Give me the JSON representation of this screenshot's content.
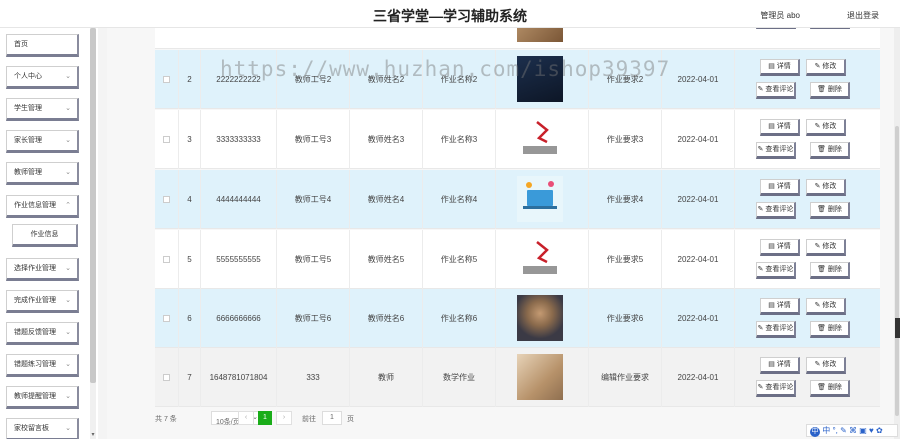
{
  "header": {
    "title": "三省学堂—学习辅助系统",
    "user": "管理员 abo",
    "logout": "退出登录"
  },
  "sidebar": {
    "items": [
      {
        "label": "首页",
        "chev": ""
      },
      {
        "label": "个人中心",
        "chev": "⌄"
      },
      {
        "label": "学生管理",
        "chev": "⌄"
      },
      {
        "label": "家长管理",
        "chev": "⌄"
      },
      {
        "label": "教师管理",
        "chev": "⌄"
      },
      {
        "label": "作业信息管理",
        "chev": "⌃"
      },
      {
        "label": "作业信息",
        "chev": ""
      },
      {
        "label": "选择作业管理",
        "chev": "⌄"
      },
      {
        "label": "完成作业管理",
        "chev": "⌄"
      },
      {
        "label": "错题反馈管理",
        "chev": "⌄"
      },
      {
        "label": "错题练习管理",
        "chev": "⌄"
      },
      {
        "label": "教师提醒管理",
        "chev": "⌄"
      },
      {
        "label": "家校留言板",
        "chev": "⌄"
      }
    ]
  },
  "table": {
    "rows": [
      {
        "idx": "2",
        "teacher_no": "2222222222",
        "teacher_id": "教师工号2",
        "teacher_name": "教师姓名2",
        "work_name": "作业名称2",
        "image": "dark-poster-image",
        "req": "作业要求2",
        "date": "2022-04-01"
      },
      {
        "idx": "3",
        "teacher_no": "3333333333",
        "teacher_id": "教师工号3",
        "teacher_name": "教师姓名3",
        "work_name": "作业名称3",
        "image": "sql-server-logo-image",
        "req": "作业要求3",
        "date": "2022-04-01"
      },
      {
        "idx": "4",
        "teacher_no": "4444444444",
        "teacher_id": "教师工号4",
        "teacher_name": "教师姓名4",
        "work_name": "作业名称4",
        "image": "laptop-illustration-image",
        "req": "作业要求4",
        "date": "2022-04-01"
      },
      {
        "idx": "5",
        "teacher_no": "5555555555",
        "teacher_id": "教师工号5",
        "teacher_name": "教师姓名5",
        "work_name": "作业名称5",
        "image": "sql-server-logo-image",
        "req": "作业要求5",
        "date": "2022-04-01"
      },
      {
        "idx": "6",
        "teacher_no": "6666666666",
        "teacher_id": "教师工号6",
        "teacher_name": "教师姓名6",
        "work_name": "作业名称6",
        "image": "student-photo-image",
        "req": "作业要求6",
        "date": "2022-04-01"
      },
      {
        "idx": "7",
        "teacher_no": "1648781071804",
        "teacher_id": "333",
        "teacher_name": "教师",
        "work_name": "数学作业",
        "image": "book-photo-image",
        "req": "编辑作业要求",
        "date": "2022-04-01"
      }
    ],
    "buttons": {
      "detail": "详情",
      "edit": "修改",
      "comments": "查看评论",
      "delete": "删除",
      "detail_icon": "document-icon",
      "edit_icon": "pencil-icon",
      "comments_icon": "pencil-icon",
      "delete_icon": "trash-icon"
    }
  },
  "pagination": {
    "total": "共 7 条",
    "page_size": "10条/页",
    "current": "1",
    "goto": "前往",
    "goto_value": "1",
    "page_unit": "页",
    "prev": "‹",
    "next": "›"
  },
  "watermark": "https://www.huzhan.com/ishop39397",
  "ime": {
    "badge": "中",
    "icons": "中 °, ✎ ⌘ ▣ ♥ ✿"
  }
}
